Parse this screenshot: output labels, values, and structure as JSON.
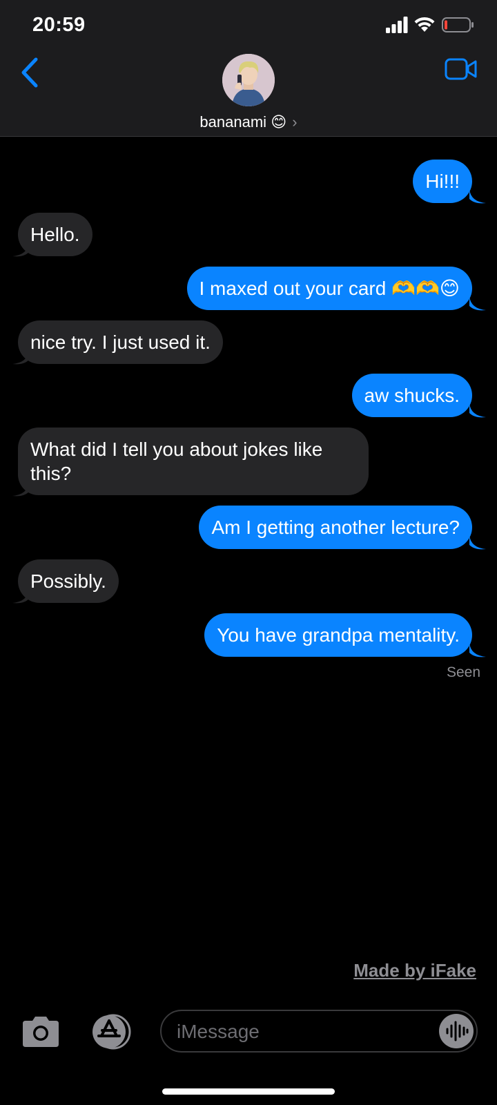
{
  "status_bar": {
    "time": "20:59"
  },
  "header": {
    "contact_name": "bananami",
    "contact_emoji": "😊",
    "chevron": "›",
    "back_icon": "chevron-left-icon",
    "video_icon": "video-camera-icon"
  },
  "messages": [
    {
      "direction": "out",
      "text": "Hi!!!"
    },
    {
      "direction": "in",
      "text": "Hello."
    },
    {
      "direction": "out",
      "text": "I maxed out your card 🫶🫶😊"
    },
    {
      "direction": "in",
      "text": "nice try. I just used it."
    },
    {
      "direction": "out",
      "text": "aw shucks."
    },
    {
      "direction": "in",
      "text": "What did I tell you about jokes like this?"
    },
    {
      "direction": "out",
      "text": "Am I getting another lecture?"
    },
    {
      "direction": "in",
      "text": "Possibly."
    },
    {
      "direction": "out",
      "text": "You have grandpa mentality."
    }
  ],
  "seen_label": "Seen",
  "watermark": "Made by iFake",
  "composer": {
    "placeholder": "iMessage",
    "camera_icon": "camera-icon",
    "apps_icon": "app-store-icon",
    "audio_icon": "waveform-icon"
  },
  "colors": {
    "outgoing_bubble": "#0a84ff",
    "incoming_bubble": "#262628",
    "accent": "#0a84ff",
    "header_bg": "#1c1c1e"
  }
}
